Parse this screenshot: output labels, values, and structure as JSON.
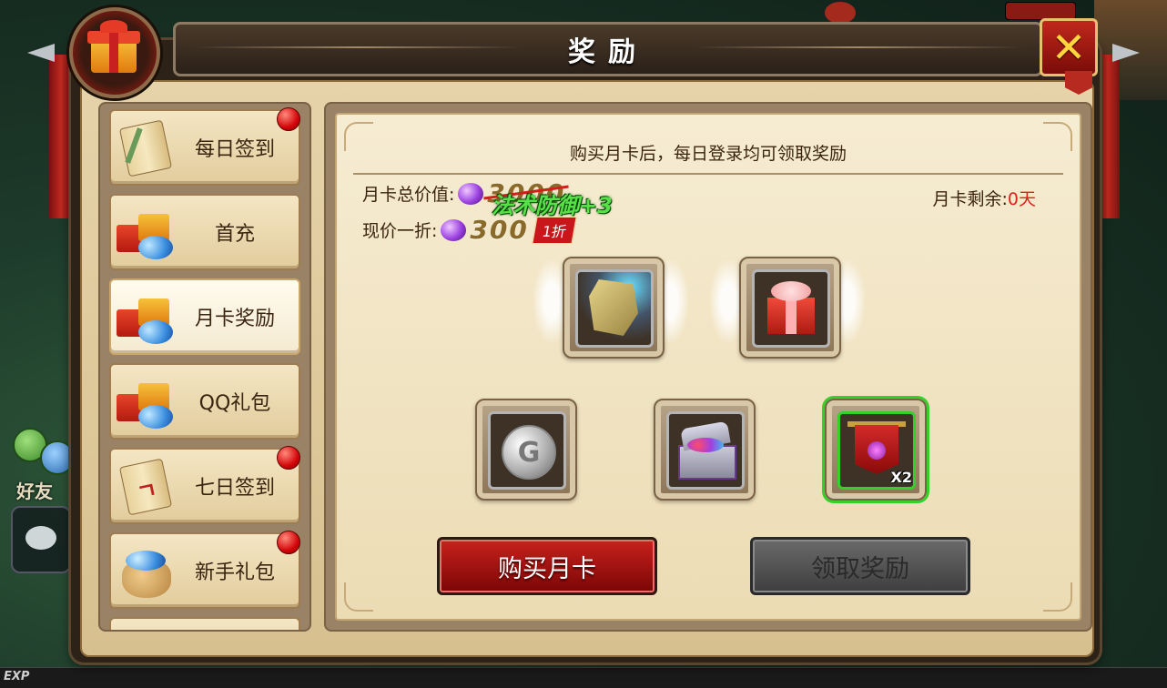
{
  "window": {
    "title": "奖励",
    "close_label": "✕"
  },
  "background": {
    "friend_label": "好友",
    "exp_label": "EXP"
  },
  "menu": {
    "items": [
      {
        "label": "每日签到",
        "icon": "scroll-icon",
        "badge": true,
        "active": false
      },
      {
        "label": "首充",
        "icon": "gift-pile-icon",
        "badge": false,
        "active": false
      },
      {
        "label": "月卡奖励",
        "icon": "gift-pile-icon",
        "badge": false,
        "active": true
      },
      {
        "label": "QQ礼包",
        "icon": "gift-pile-icon",
        "badge": false,
        "active": false
      },
      {
        "label": "七日签到",
        "icon": "scroll-icon",
        "badge": true,
        "active": false
      },
      {
        "label": "新手礼包",
        "icon": "gem-bag-icon",
        "badge": true,
        "active": false
      }
    ]
  },
  "monthly_card": {
    "notice": "购买月卡后，每日登录均可领取奖励",
    "total_value_label": "月卡总价值:",
    "total_value": "3000",
    "current_price_label": "现价一折:",
    "current_price": "300",
    "discount_tag": "1折",
    "buff_text": "法术防御+3",
    "remaining_label": "月卡剩余:",
    "remaining_value": "0天",
    "buy_button": "购买月卡",
    "claim_button": "领取奖励"
  },
  "rewards": {
    "featured": [
      {
        "icon": "rune-stone-icon"
      },
      {
        "icon": "gift-box-icon"
      }
    ],
    "daily": [
      {
        "icon": "silver-coin-icon",
        "qty": ""
      },
      {
        "icon": "treasure-chest-icon",
        "qty": ""
      },
      {
        "icon": "banner-icon",
        "qty": "X2"
      }
    ]
  },
  "colors": {
    "accent_red": "#c8221c",
    "highlight_green": "#36d02a",
    "remaining_red": "#e0201a"
  }
}
